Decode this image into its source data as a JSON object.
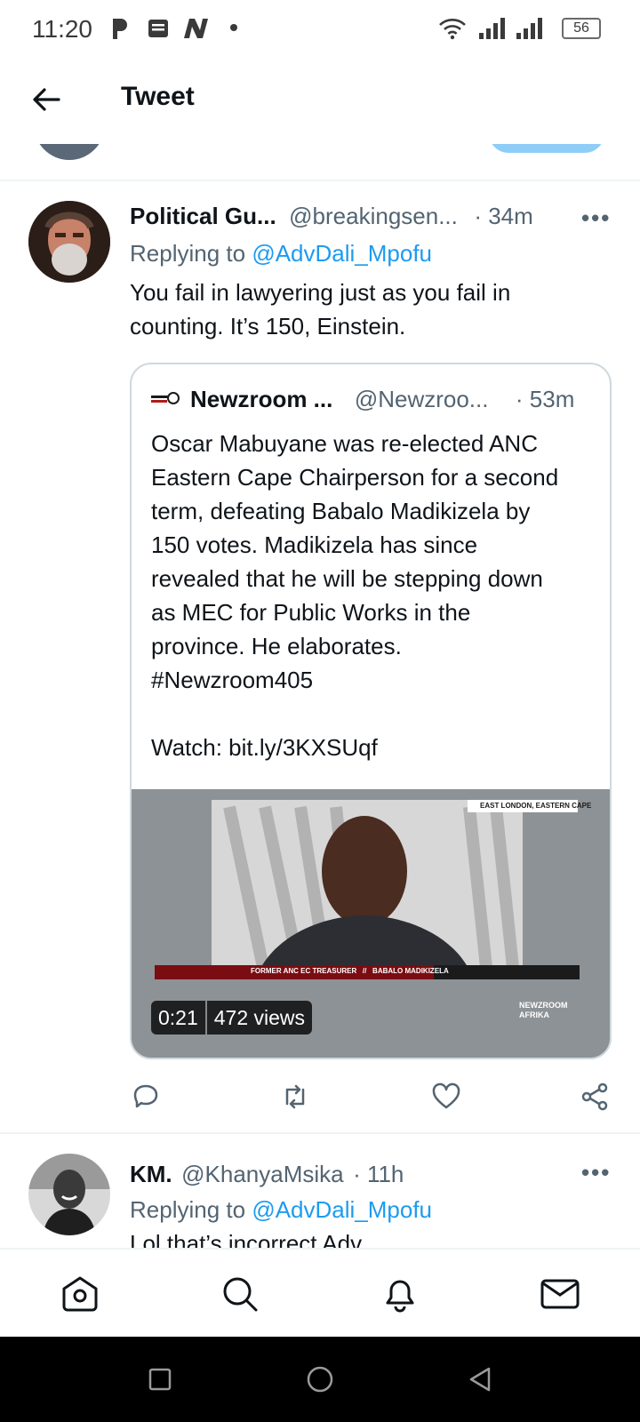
{
  "status_bar": {
    "time": "11:20",
    "battery": "56"
  },
  "header": {
    "title": "Tweet"
  },
  "tweet1": {
    "name": "Political Gu...",
    "handle": "@breakingsen...",
    "time": "· 34m",
    "replying_prefix": "Replying to",
    "replying_to": "@AdvDali_Mpofu",
    "text": "You fail in lawyering just as you fail in\ncounting. It’s 150, Einstein.",
    "quote": {
      "name": "Newzroom ...",
      "handle": "@Newzroo...",
      "time": "· 53m",
      "text": "Oscar Mabuyane was re-elected ANC\nEastern Cape Chairperson for a second\nterm, defeating Babalo Madikizela by\n150 votes. Madikizela has since\nrevealed that he will be stepping down\nas MEC for Public Works in the\nprovince. He elaborates.\n#Newzroom405\n\nWatch: bit.ly/3KXSUqf",
      "video": {
        "duration": "0:21",
        "views": "472 views",
        "location_tag": "EAST LONDON, EASTERN CAPE",
        "lower_third": "FORMER ANC EC TREASURER   //   BABALO MADIKIZELA",
        "watermark": "NEWZROOM AFRIKA"
      },
      "logo_text": "NEWZROOM AFRIKA"
    },
    "more": "•••"
  },
  "tweet2": {
    "name": "KM.",
    "handle": "@KhanyaMsika",
    "time": "· 11h",
    "replying_prefix": "Replying to",
    "replying_to": "@AdvDali_Mpofu",
    "text": "Lol that’s incorrect Adv",
    "more": "•••"
  },
  "icons": {
    "back": "arrow-left-icon",
    "reply": "reply-icon",
    "retweet": "retweet-icon",
    "like": "heart-icon",
    "share": "share-icon",
    "home": "home-icon",
    "search": "search-icon",
    "notifications": "bell-icon",
    "messages": "mail-icon"
  },
  "colors": {
    "link": "#1d9bf0",
    "secondary_text": "#536471",
    "primary_text": "#0f1419",
    "border": "#cfd9de"
  }
}
